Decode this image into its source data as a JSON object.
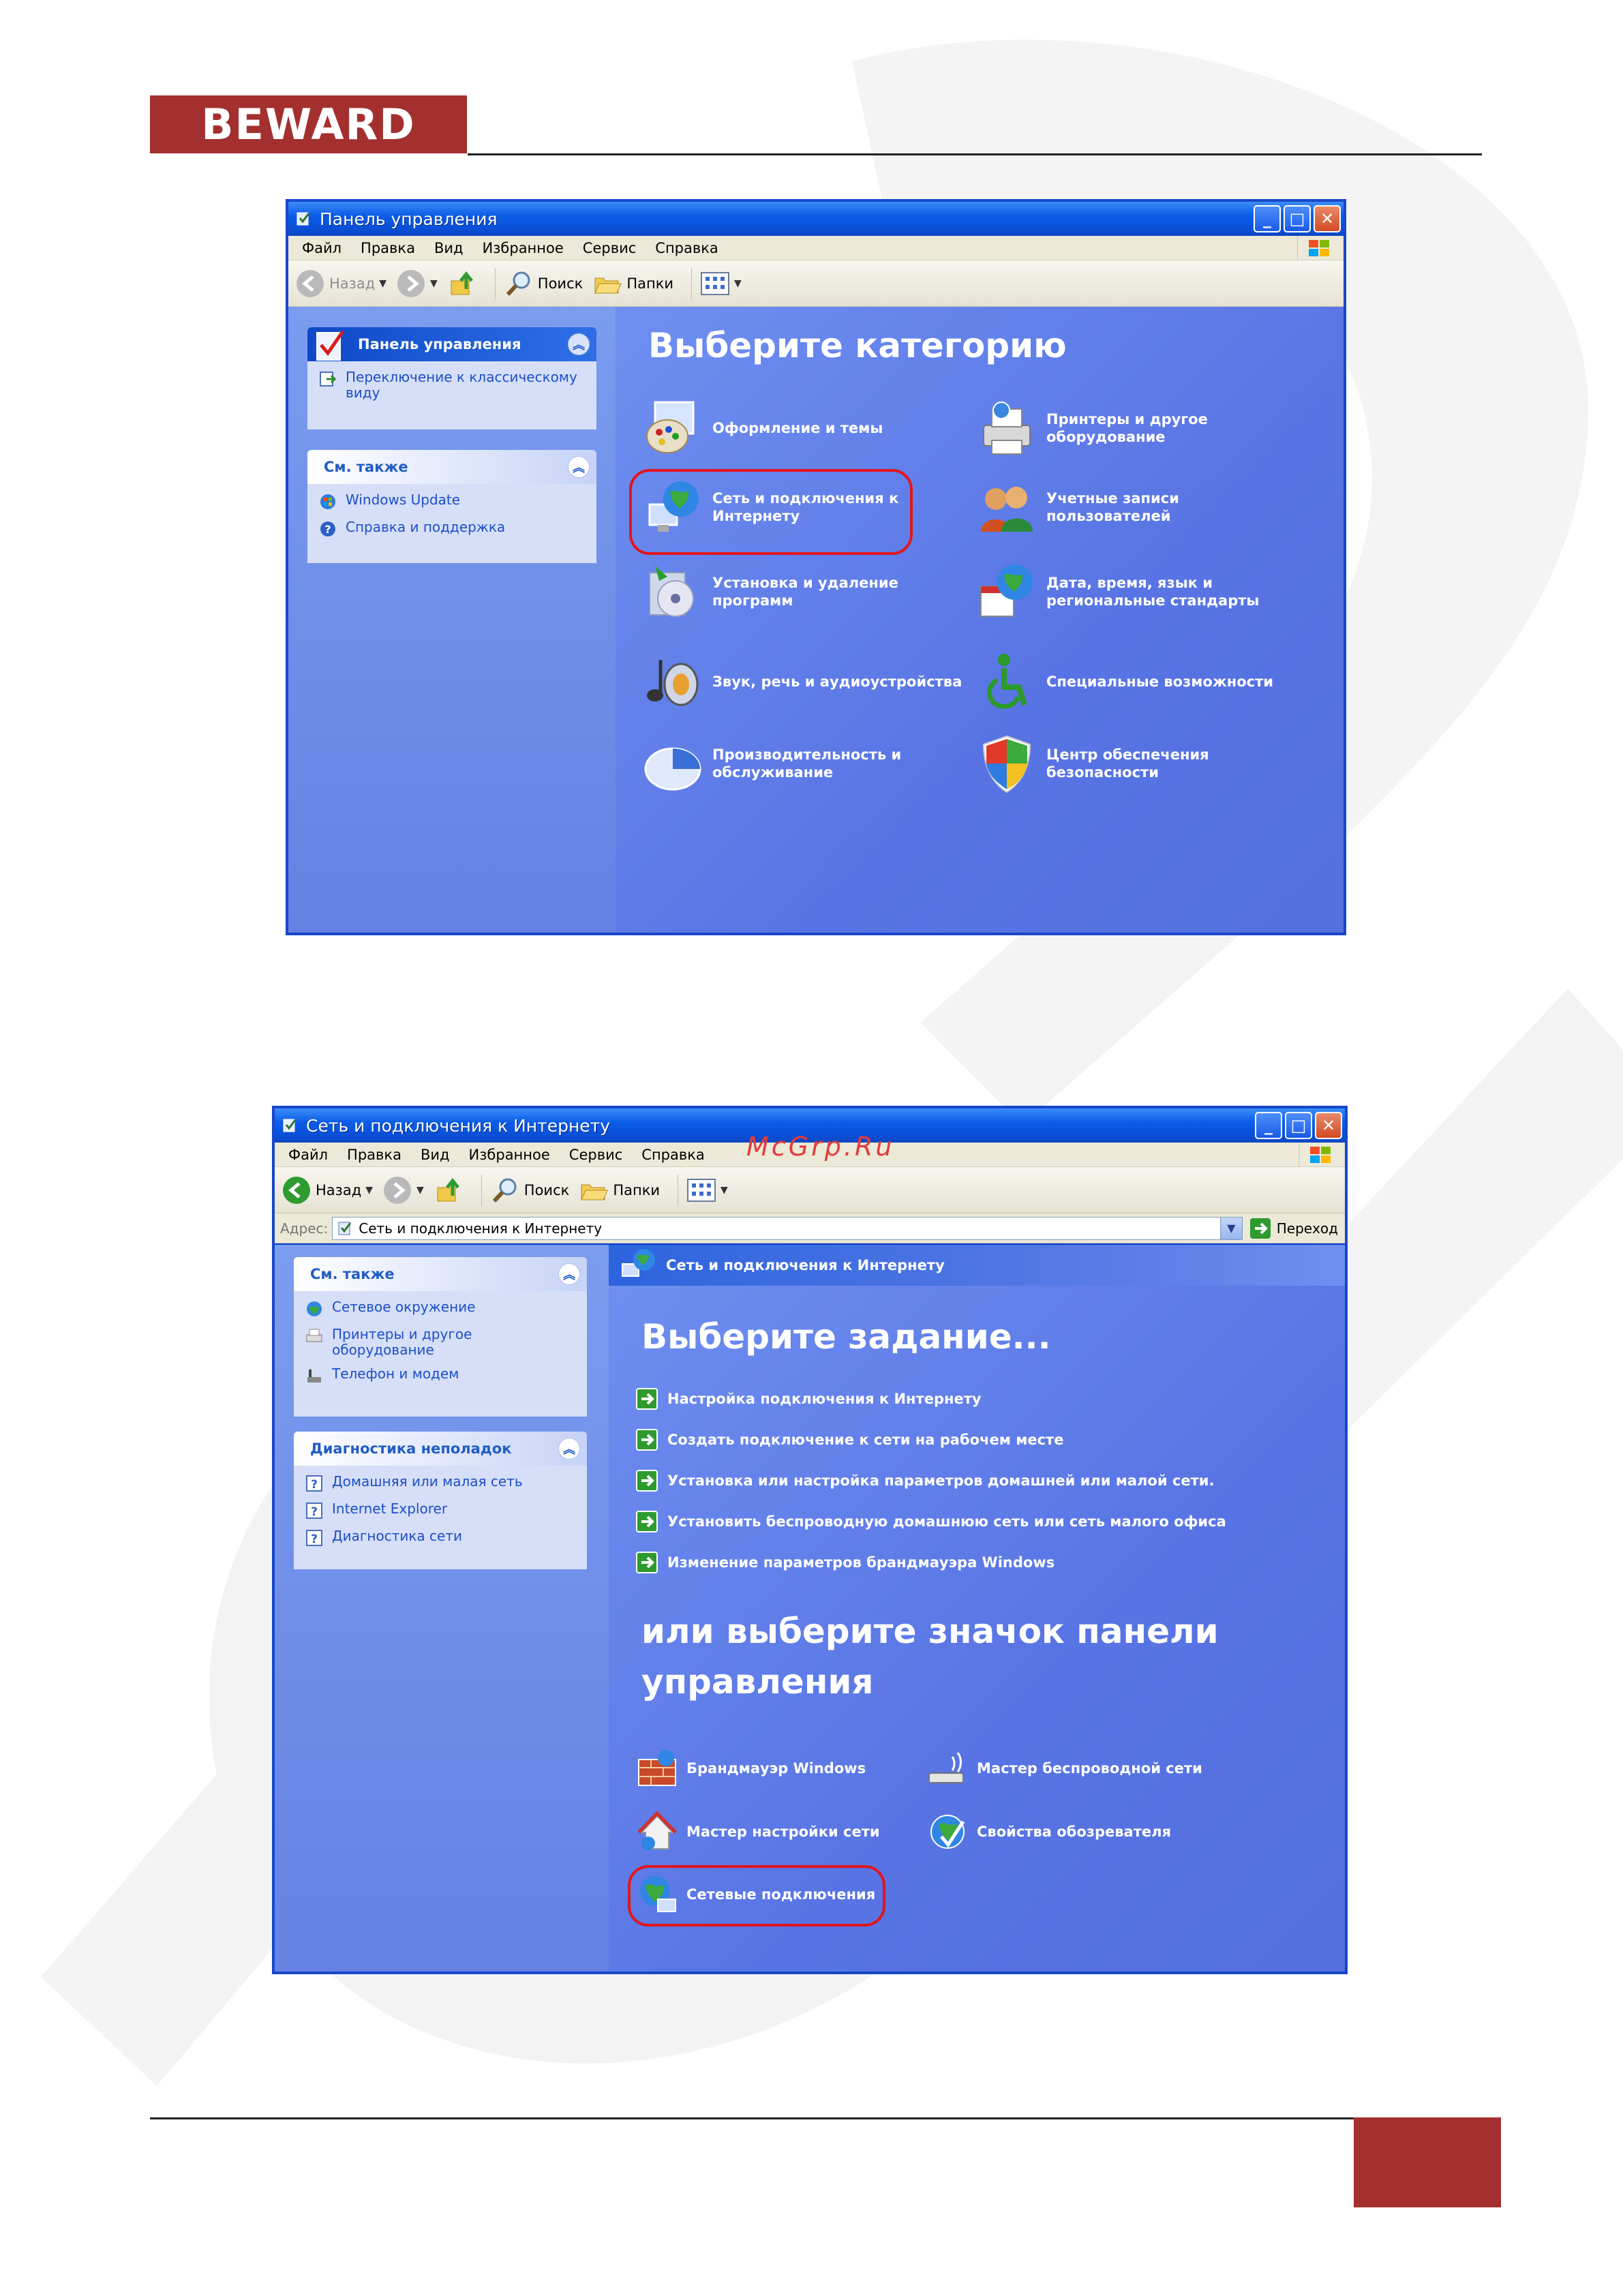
{
  "brand": {
    "logo_text": "BEWARD"
  },
  "watermark_text": "McGrp.Ru",
  "window1": {
    "title": "Панель управления",
    "menu": [
      "Файл",
      "Правка",
      "Вид",
      "Избранное",
      "Сервис",
      "Справка"
    ],
    "toolbar": {
      "back": "Назад",
      "search": "Поиск",
      "folders": "Папки"
    },
    "sidebar": {
      "panel1": {
        "title": "Панель управления",
        "links": [
          "Переключение к классическому виду"
        ]
      },
      "panel2": {
        "title": "См. также",
        "links": [
          "Windows Update",
          "Справка и поддержка"
        ]
      }
    },
    "heading": "Выберите категорию",
    "categories": [
      {
        "label": "Оформление и темы",
        "icon": "appearance-themes-icon"
      },
      {
        "label": "Принтеры и другое оборудование",
        "icon": "printer-icon"
      },
      {
        "label": "Сеть и подключения к Интернету",
        "icon": "network-globe-icon",
        "highlighted": true
      },
      {
        "label": "Учетные записи пользователей",
        "icon": "user-accounts-icon"
      },
      {
        "label": "Установка и удаление программ",
        "icon": "add-remove-programs-icon"
      },
      {
        "label": "Дата, время, язык и региональные стандарты",
        "icon": "date-time-icon"
      },
      {
        "label": "Звук, речь и аудиоустройства",
        "icon": "sound-icon"
      },
      {
        "label": "Специальные возможности",
        "icon": "accessibility-icon"
      },
      {
        "label": "Производительность и обслуживание",
        "icon": "performance-icon"
      },
      {
        "label": "Центр обеспечения безопасности",
        "icon": "security-shield-icon"
      }
    ]
  },
  "window2": {
    "title": "Сеть и подключения к Интернету",
    "menu": [
      "Файл",
      "Правка",
      "Вид",
      "Избранное",
      "Сервис",
      "Справка"
    ],
    "toolbar": {
      "back": "Назад",
      "search": "Поиск",
      "folders": "Папки"
    },
    "address": {
      "label": "Адрес:",
      "value": "Сеть и подключения к Интернету",
      "go": "Переход"
    },
    "sidebar": {
      "panel1": {
        "title": "См. также",
        "links": [
          "Сетевое окружение",
          "Принтеры и другое оборудование",
          "Телефон и модем"
        ]
      },
      "panel2": {
        "title": "Диагностика неполадок",
        "links": [
          "Домашняя или малая сеть",
          "Internet Explorer",
          "Диагностика сети"
        ]
      }
    },
    "header_strip": "Сеть и подключения к Интернету",
    "task_heading": "Выберите задание...",
    "tasks": [
      "Настройка подключения к Интернету",
      "Создать подключение к сети на рабочем месте",
      "Установка или настройка параметров домашней или малой сети.",
      "Установить беспроводную домашнюю сеть или сеть малого офиса",
      "Изменение параметров брандмауэра Windows"
    ],
    "icon_heading_line1": "или выберите значок панели",
    "icon_heading_line2": "управления",
    "cp_icons": [
      {
        "label": "Брандмауэр Windows",
        "icon": "firewall-icon"
      },
      {
        "label": "Мастер беспроводной сети",
        "icon": "wireless-icon"
      },
      {
        "label": "Мастер настройки сети",
        "icon": "network-setup-icon"
      },
      {
        "label": "Свойства обозревателя",
        "icon": "internet-options-icon"
      },
      {
        "label": "Сетевые подключения",
        "icon": "network-connections-icon",
        "highlighted": true
      }
    ]
  },
  "colors": {
    "brand_red": "#a3302e",
    "xp_blue": "#0a4fd6",
    "highlight_red": "#e2151d"
  }
}
